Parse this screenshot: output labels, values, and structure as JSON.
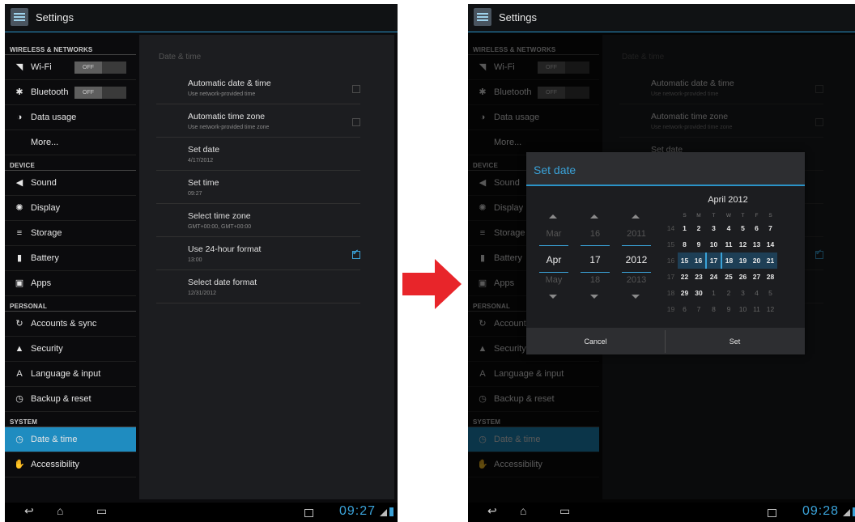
{
  "left": {
    "title": "Settings",
    "sections": [
      {
        "header": "WIRELESS & NETWORKS",
        "items": [
          {
            "icon": "wifi-icon",
            "glyph": "◥",
            "label": "Wi-Fi",
            "toggle": "OFF"
          },
          {
            "icon": "bluetooth-icon",
            "glyph": "✱",
            "label": "Bluetooth",
            "toggle": "OFF"
          },
          {
            "icon": "data-usage-icon",
            "glyph": "◑",
            "label": "Data usage"
          },
          {
            "icon": "",
            "glyph": "",
            "label": "More..."
          }
        ]
      },
      {
        "header": "DEVICE",
        "items": [
          {
            "icon": "sound-icon",
            "glyph": "◀",
            "label": "Sound"
          },
          {
            "icon": "display-icon",
            "glyph": "✺",
            "label": "Display"
          },
          {
            "icon": "storage-icon",
            "glyph": "≡",
            "label": "Storage"
          },
          {
            "icon": "battery-icon",
            "glyph": "▮",
            "label": "Battery"
          },
          {
            "icon": "apps-icon",
            "glyph": "▣",
            "label": "Apps"
          }
        ]
      },
      {
        "header": "PERSONAL",
        "items": [
          {
            "icon": "sync-icon",
            "glyph": "↻",
            "label": "Accounts & sync"
          },
          {
            "icon": "lock-icon",
            "glyph": "▲",
            "label": "Security"
          },
          {
            "icon": "language-icon",
            "glyph": "A",
            "label": "Language & input"
          },
          {
            "icon": "backup-icon",
            "glyph": "◷",
            "label": "Backup & reset"
          }
        ]
      },
      {
        "header": "SYSTEM",
        "items": [
          {
            "icon": "clock-icon",
            "glyph": "◷",
            "label": "Date & time",
            "selected": true
          },
          {
            "icon": "accessibility-icon",
            "glyph": "✋",
            "label": "Accessibility"
          }
        ]
      }
    ],
    "content_title": "Date & time",
    "rows": [
      {
        "title": "Automatic date & time",
        "sub": "Use network-provided time",
        "checkbox": false
      },
      {
        "title": "Automatic time zone",
        "sub": "Use network-provided time zone",
        "checkbox": false
      },
      {
        "title": "Set date",
        "sub": "4/17/2012"
      },
      {
        "title": "Set time",
        "sub": "09:27"
      },
      {
        "title": "Select time zone",
        "sub": "GMT+00:00, GMT+00:00"
      },
      {
        "title": "Use 24-hour format",
        "sub": "13:00",
        "checkbox": true
      },
      {
        "title": "Select date format",
        "sub": "12/31/2012"
      }
    ],
    "clock": "09:27"
  },
  "right": {
    "title": "Settings",
    "clock": "09:28",
    "dialog": {
      "title": "Set date",
      "spinners": [
        {
          "prev": "Mar",
          "cur": "Apr",
          "next": "May"
        },
        {
          "prev": "16",
          "cur": "17",
          "next": "18"
        },
        {
          "prev": "2011",
          "cur": "2012",
          "next": "2013"
        }
      ],
      "calendar_title": "April 2012",
      "weekdays": [
        "S",
        "M",
        "T",
        "W",
        "T",
        "F",
        "S"
      ],
      "weeks": [
        {
          "wk": "14",
          "days": [
            "1",
            "2",
            "3",
            "4",
            "5",
            "6",
            "7"
          ]
        },
        {
          "wk": "15",
          "days": [
            "8",
            "9",
            "10",
            "11",
            "12",
            "13",
            "14"
          ]
        },
        {
          "wk": "16",
          "days": [
            "15",
            "16",
            "17",
            "18",
            "19",
            "20",
            "21"
          ]
        },
        {
          "wk": "17",
          "days": [
            "22",
            "23",
            "24",
            "25",
            "26",
            "27",
            "28"
          ]
        },
        {
          "wk": "18",
          "days": [
            "29",
            "30",
            "1",
            "2",
            "3",
            "4",
            "5"
          ]
        },
        {
          "wk": "19",
          "days": [
            "6",
            "7",
            "8",
            "9",
            "10",
            "11",
            "12"
          ]
        }
      ],
      "cancel": "Cancel",
      "set": "Set"
    }
  },
  "arrow_color": "#e8252a",
  "accent": "#2b93c7"
}
